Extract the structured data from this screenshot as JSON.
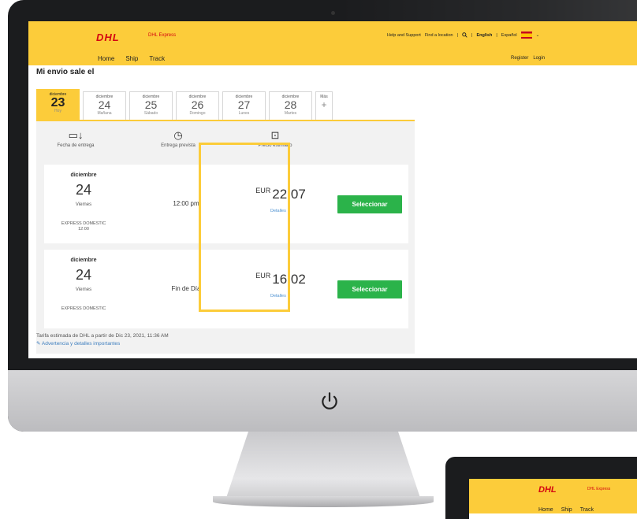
{
  "header": {
    "logo_text": "DHL",
    "logo_sub": "DHL Express",
    "help_link": "Help and Support",
    "find_location": "Find a location",
    "lang_english": "English",
    "lang_espanol": "Español"
  },
  "nav": {
    "items": [
      "Home",
      "Ship",
      "Track"
    ],
    "register": "Register",
    "login": "Login"
  },
  "page_title": "Mi envio sale el",
  "dates": [
    {
      "month": "diciembre",
      "day": "23",
      "weekday": "Hoy"
    },
    {
      "month": "diciembre",
      "day": "24",
      "weekday": "Mañana"
    },
    {
      "month": "diciembre",
      "day": "25",
      "weekday": "Sábado"
    },
    {
      "month": "diciembre",
      "day": "26",
      "weekday": "Domingo"
    },
    {
      "month": "diciembre",
      "day": "27",
      "weekday": "Lunes"
    },
    {
      "month": "diciembre",
      "day": "28",
      "weekday": "Martes"
    }
  ],
  "more_dates": {
    "label": "Más",
    "icon": "+"
  },
  "columns": {
    "delivery_date": "Fecha de entrega",
    "expected_delivery": "Entrega prevista",
    "estimated_price": "Precio estimado"
  },
  "options": [
    {
      "month": "diciembre",
      "day": "24",
      "weekday": "Viernes",
      "service": "EXPRESS DOMESTIC",
      "service_time": "12:00",
      "delivery_time": "12:00 pm",
      "currency": "EUR",
      "price": "22,07",
      "details": "Detalles ⌄",
      "select_label": "Seleccionar"
    },
    {
      "month": "diciembre",
      "day": "24",
      "weekday": "Viernes",
      "service": "EXPRESS DOMESTIC",
      "service_time": "",
      "delivery_time": "Fin de Día",
      "currency": "EUR",
      "price": "16,02",
      "details": "Detalles ⌄",
      "select_label": "Seleccionar"
    }
  ],
  "footer": {
    "rate_note": "Tarifa estimada de DHL a partir de Dic 23, 2021, 11:36 AM",
    "warning_link": "Advertencia y detalles importantes"
  },
  "second_monitor": {
    "logo_text": "DHL",
    "logo_sub": "DHL Express",
    "nav": [
      "Home",
      "Ship",
      "Track"
    ]
  },
  "colors": {
    "dhl_yellow": "#fccc3a",
    "dhl_red": "#d40511",
    "select_green": "#2bb34a",
    "link_blue": "#4a8fd0"
  },
  "icons": {
    "search": "search-icon",
    "calendar": "calendar-icon",
    "clock": "clock-icon",
    "money": "money-icon",
    "power": "power-icon"
  }
}
